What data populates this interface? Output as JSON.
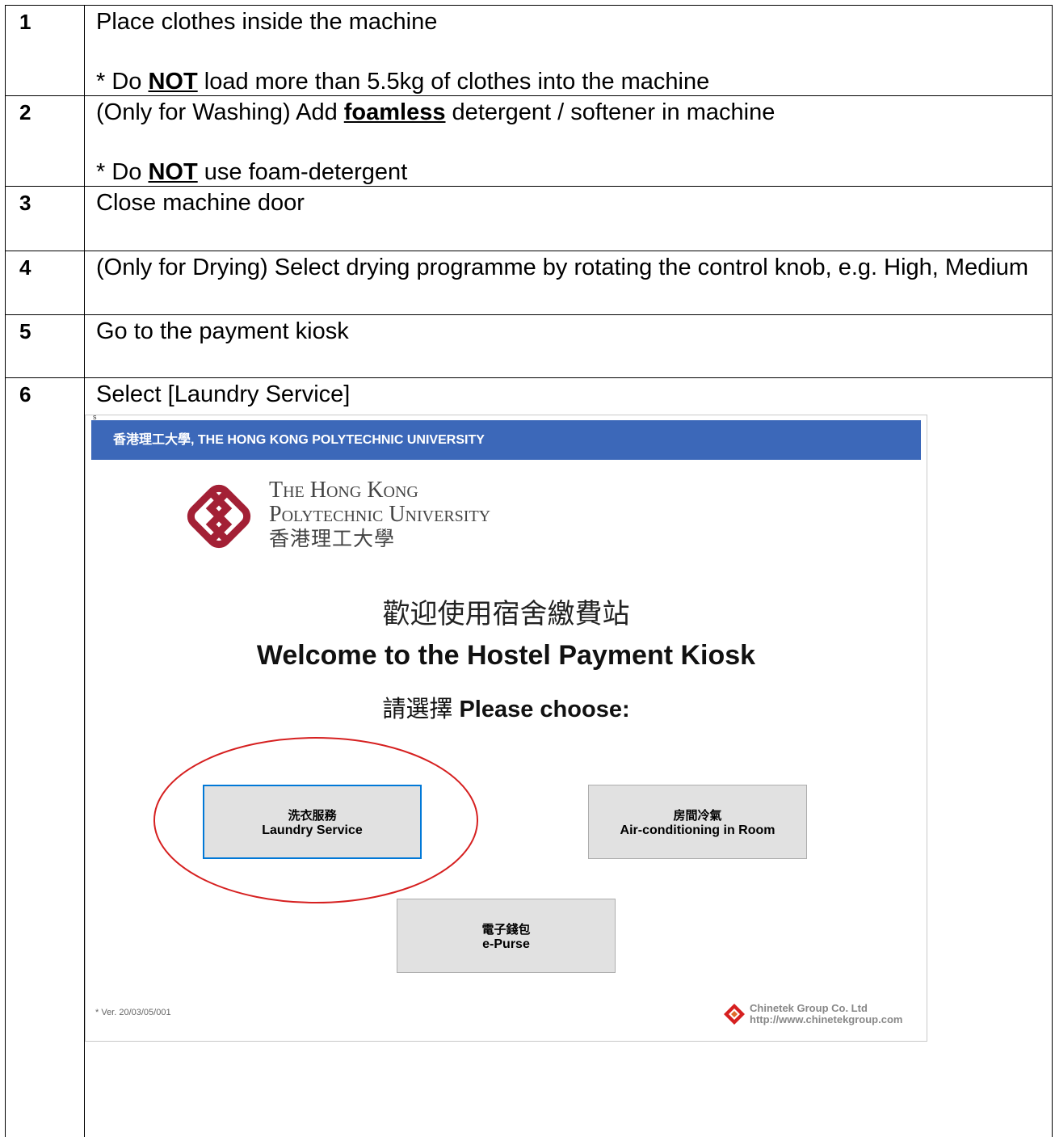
{
  "steps": [
    {
      "num": "1",
      "text": "Place clothes inside the machine",
      "note_prefix": "* Do ",
      "note_em": "NOT",
      "note_suffix": " load more than 5.5kg of clothes into the machine"
    },
    {
      "num": "2",
      "text_prefix": "(Only for Washing) Add ",
      "text_em": "foamless",
      "text_suffix": " detergent / softener in machine",
      "note_prefix": "* Do ",
      "note_em": "NOT",
      "note_suffix": " use foam-detergent"
    },
    {
      "num": "3",
      "text": "Close machine door"
    },
    {
      "num": "4",
      "text": "(Only for Drying) Select drying programme by rotating the control knob, e.g. High, Medium"
    },
    {
      "num": "5",
      "text": "Go to the payment kiosk"
    },
    {
      "num": "6",
      "text": "Select [Laundry Service]"
    }
  ],
  "kiosk": {
    "marker": "s",
    "header": "香港理工大學, THE HONG KONG POLYTECHNIC UNIVERSITY",
    "logo_line1": "The Hong Kong",
    "logo_line2": "Polytechnic University",
    "logo_line3": "香港理工大學",
    "welcome_cn": "歡迎使用宿舍繳費站",
    "welcome_en": "Welcome to the Hostel Payment Kiosk",
    "choose_cn": "請選擇",
    "choose_en": "Please choose:",
    "buttons": {
      "laundry": {
        "cn": "洗衣服務",
        "en": "Laundry Service"
      },
      "ac": {
        "cn": "房間冷氣",
        "en": "Air-conditioning in Room"
      },
      "epurse": {
        "cn": "電子錢包",
        "en": "e-Purse"
      }
    },
    "version": "* Ver. 20/03/05/001",
    "vendor_name": "Chinetek Group Co. Ltd",
    "vendor_url": "http://www.chinetekgroup.com",
    "colors": {
      "header_bar": "#3c68b9",
      "logo": "#a32035",
      "highlight": "#d62020",
      "selected_border": "#0078d7"
    }
  }
}
